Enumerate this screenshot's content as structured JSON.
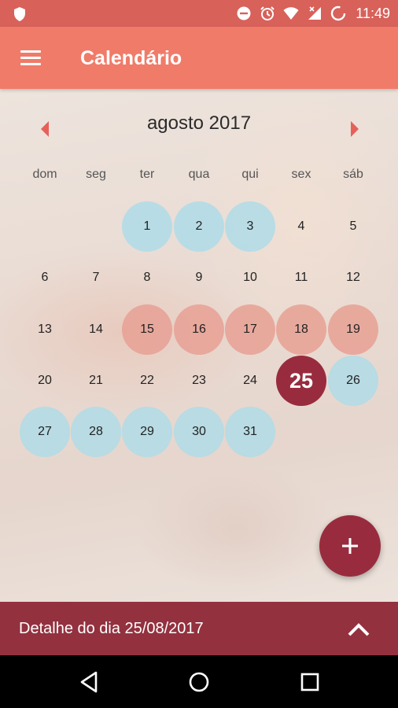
{
  "status_bar": {
    "time": "11:49",
    "icons": [
      "shield-icon",
      "do-not-disturb-icon",
      "alarm-icon",
      "wifi-icon",
      "signal-icon",
      "battery-icon"
    ]
  },
  "app_bar": {
    "title": "Calendário",
    "menu_icon": "menu-icon"
  },
  "calendar": {
    "month_label": "agosto 2017",
    "weekdays": [
      "dom",
      "seg",
      "ter",
      "qua",
      "qui",
      "sex",
      "sáb"
    ],
    "first_weekday_index": 2,
    "days_in_month": 31,
    "today": 25,
    "blue_days": [
      1,
      2,
      3,
      26,
      27,
      28,
      29,
      30,
      31
    ],
    "pink_days": [
      15,
      16,
      17,
      18,
      19
    ]
  },
  "fab": {
    "label": "+",
    "icon": "add-icon"
  },
  "detail_bar": {
    "label": "Detalhe do dia 25/08/2017",
    "icon": "chevron-up-icon"
  },
  "nav_bar": {
    "icons": [
      "back-icon",
      "home-icon",
      "recents-icon"
    ]
  },
  "colors": {
    "status_bar": "#d8615a",
    "app_bar": "#f07b69",
    "accent": "#982c3e",
    "detail_bar": "#93313f",
    "blue_day": "#afdce8",
    "pink_day": "#e8a094"
  }
}
